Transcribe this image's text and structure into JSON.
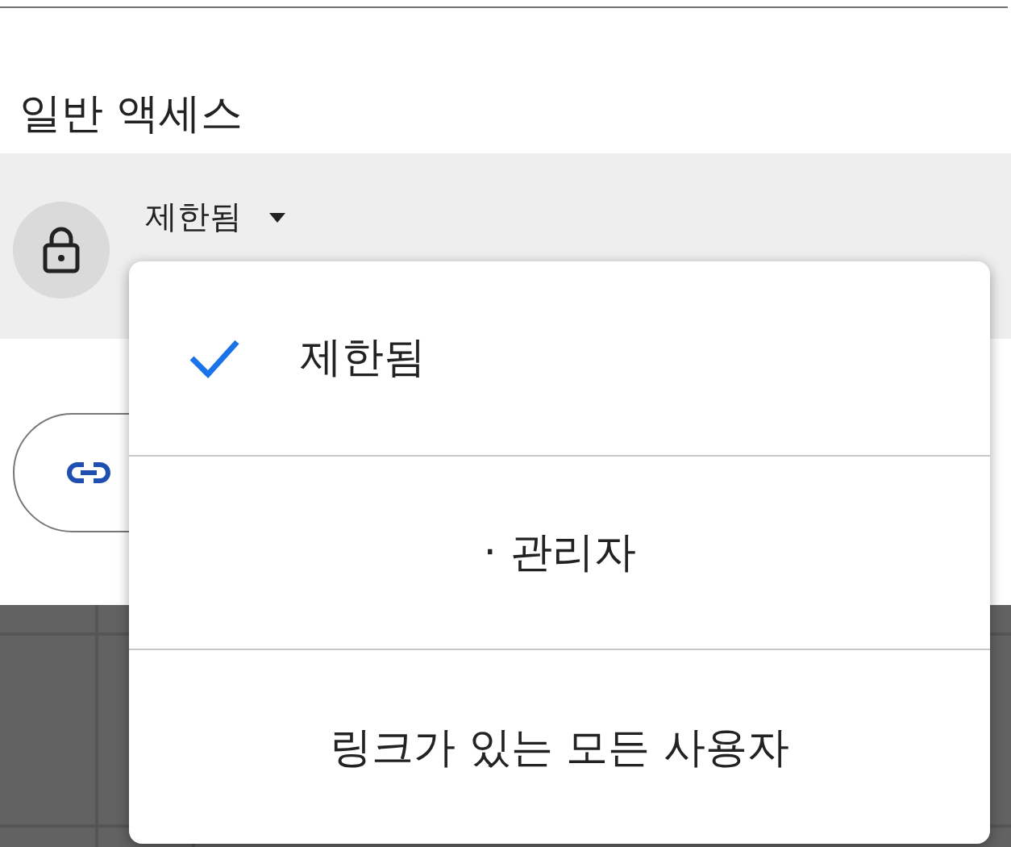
{
  "section_title": "일반 액세스",
  "access": {
    "value": "제한됨"
  },
  "menu": [
    {
      "label": "제한됨",
      "selected": true
    },
    {
      "label": "· 관리자",
      "selected": false
    },
    {
      "label": "링크가 있는 모든 사용자",
      "selected": false
    }
  ]
}
